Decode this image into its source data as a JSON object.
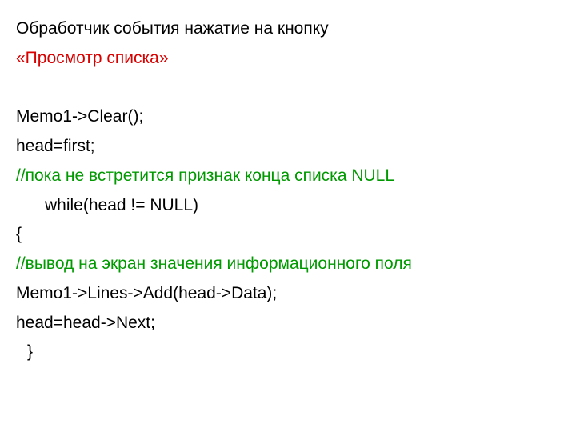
{
  "lines": [
    {
      "text": "Обработчик события нажатие на кнопку",
      "color": "black",
      "indent": ""
    },
    {
      "text": "«Просмотр списка»",
      "color": "red",
      "indent": ""
    },
    {
      "text": " ",
      "color": "black",
      "indent": ""
    },
    {
      "text": "Memo1->Clear();",
      "color": "black",
      "indent": ""
    },
    {
      "text": "head=first;",
      "color": "black",
      "indent": ""
    },
    {
      "text": "//пока не встретится признак конца списка NULL",
      "color": "green",
      "indent": ""
    },
    {
      "text": "while(head != NULL)",
      "color": "black",
      "indent": "indent"
    },
    {
      "text": "{",
      "color": "black",
      "indent": ""
    },
    {
      "text": "//вывод на экран значения информационного поля",
      "color": "green",
      "indent": ""
    },
    {
      "text": "Memo1->Lines->Add(head->Data);",
      "color": "black",
      "indent": ""
    },
    {
      "text": "head=head->Next;",
      "color": "black",
      "indent": ""
    },
    {
      "text": "}",
      "color": "black",
      "indent": "indent-small"
    }
  ]
}
